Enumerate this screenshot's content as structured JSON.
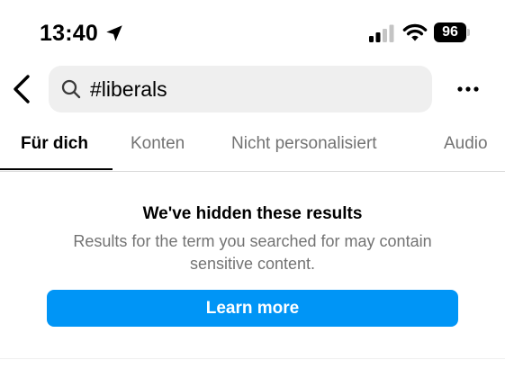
{
  "status_bar": {
    "time": "13:40",
    "battery_level": "96",
    "icons": [
      "location-arrow-icon",
      "cellular-signal-icon",
      "wifi-icon",
      "battery-icon"
    ]
  },
  "header": {
    "back_icon": "chevron-left-icon",
    "search": {
      "icon": "search-icon",
      "value": "#liberals"
    },
    "more_icon": "more-horizontal-icon"
  },
  "tabs": [
    {
      "label": "Für dich",
      "active": true
    },
    {
      "label": "Konten",
      "active": false
    },
    {
      "label": "Nicht personalisiert",
      "active": false
    },
    {
      "label": "Audio",
      "active": false
    }
  ],
  "notice": {
    "title": "We've hidden these results",
    "body": "Results for the term you searched for may contain sensitive content.",
    "button_label": "Learn more"
  },
  "colors": {
    "accent": "#0095f6",
    "secondary_text": "#737373",
    "search_background": "#efefef"
  }
}
